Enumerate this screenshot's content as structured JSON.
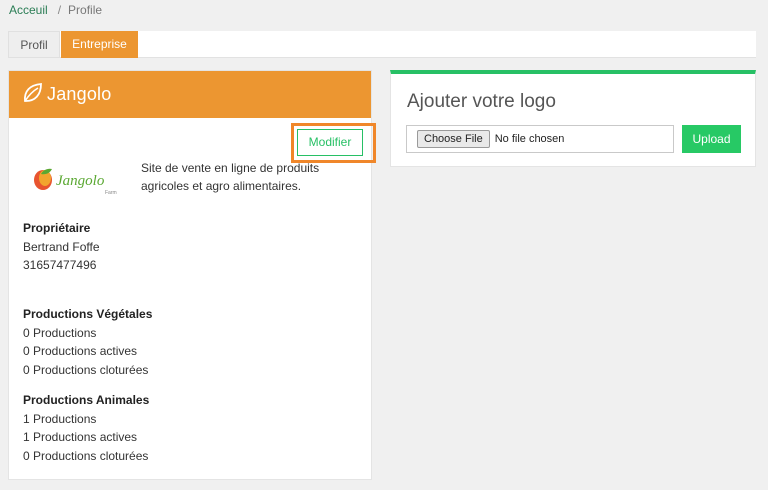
{
  "breadcrumb": {
    "home": "Acceuil",
    "separator": "/",
    "current": "Profile"
  },
  "tabs": {
    "profil": "Profil",
    "entreprise": "Entreprise"
  },
  "company": {
    "brand": "Jangolo",
    "logo_text": "Jangolo",
    "logo_subtext": "Farm",
    "modifier_label": "Modifier",
    "description": "Site de vente en ligne de produits agricoles et agro alimentaires."
  },
  "owner": {
    "title": "Propriétaire",
    "name": "Bertrand Foffe",
    "phone": "31657477496"
  },
  "vegetal": {
    "title": "Productions Végétales",
    "total": "0 Productions",
    "active": "0 Productions actives",
    "closed": "0 Productions cloturées"
  },
  "animal": {
    "title": "Productions Animales",
    "total": "1 Productions",
    "active": "1 Productions actives",
    "closed": "0 Productions cloturées"
  },
  "upload": {
    "heading": "Ajouter votre logo",
    "choose_label": "Choose File",
    "no_file": "No file chosen",
    "upload_label": "Upload"
  },
  "colors": {
    "accent": "#ec9631",
    "green": "#27c065",
    "highlight": "#f0872a"
  }
}
